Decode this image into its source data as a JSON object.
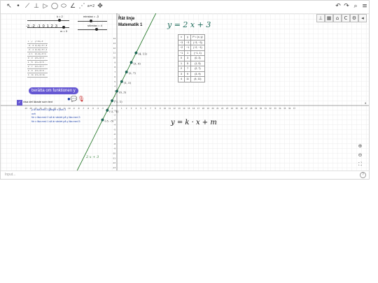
{
  "toolbar": {
    "tools": [
      {
        "name": "move-tool",
        "glyph": "↖"
      },
      {
        "name": "point-tool",
        "glyph": "•"
      },
      {
        "name": "line-tool",
        "glyph": "⟋"
      },
      {
        "name": "perpendicular-tool",
        "glyph": "⊥"
      },
      {
        "name": "polygon-tool",
        "glyph": "▷"
      },
      {
        "name": "circle-tool",
        "glyph": "◯"
      },
      {
        "name": "ellipse-tool",
        "glyph": "⬭"
      },
      {
        "name": "angle-tool",
        "glyph": "∠"
      },
      {
        "name": "reflect-tool",
        "glyph": "⋰"
      },
      {
        "name": "slider-tool",
        "glyph": "a=2"
      },
      {
        "name": "move-view-tool",
        "glyph": "✥"
      }
    ],
    "right": [
      {
        "name": "undo-icon",
        "glyph": "↶"
      },
      {
        "name": "redo-icon",
        "glyph": "↷"
      },
      {
        "name": "search-icon",
        "glyph": "⌕"
      },
      {
        "name": "menu-icon",
        "glyph": "≡"
      }
    ]
  },
  "stylebar": [
    {
      "name": "axes-toggle-icon",
      "glyph": "⊥"
    },
    {
      "name": "grid-toggle-icon",
      "glyph": "▦"
    },
    {
      "name": "home-icon",
      "glyph": "⌂"
    },
    {
      "name": "point-capture-icon",
      "glyph": "C"
    },
    {
      "name": "settings-icon",
      "glyph": "⚙"
    },
    {
      "name": "collapse-icon",
      "glyph": "◂"
    }
  ],
  "sliders": {
    "k": {
      "label": "k = 2",
      "value": 2,
      "min": -3,
      "max": 3
    },
    "m": {
      "label": "m = 3",
      "value": 3
    },
    "minsta": {
      "label": "minstax = -3",
      "value": -3
    },
    "storsta": {
      "label": "störstax = 4",
      "value": 4
    }
  },
  "number_line": {
    "ticks": [
      "-3",
      "-2",
      "-1",
      "0",
      "1",
      "2",
      "3"
    ]
  },
  "title": {
    "line1": "Rät linje",
    "line2": "Matematik 1"
  },
  "equation_main": "y = 2 x + 3",
  "equation_general": "y = k · x + m",
  "line_label": "2 x + 3",
  "table": {
    "headers": [
      "x",
      "y",
      "P = (x, y)"
    ],
    "rows": [
      [
        "−3",
        "−3",
        "(−3, −3)"
      ],
      [
        "−2",
        "−1",
        "(−2, −1)"
      ],
      [
        "−1",
        "1",
        "(−1, 1)"
      ],
      [
        "0",
        "3",
        "(0, 3)"
      ],
      [
        "1",
        "5",
        "(1, 5)"
      ],
      [
        "2",
        "7",
        "(2, 7)"
      ],
      [
        "3",
        "9",
        "(3, 9)"
      ],
      [
        "4",
        "11",
        "(4, 11)"
      ]
    ]
  },
  "calc_table": {
    "headers": [
      "x",
      "y",
      "y = 2x + 3"
    ],
    "rows": [
      [
        "−3",
        "−3",
        "2·(−3) + 3 = −3"
      ],
      [
        "−2",
        "−1",
        "2·(−2) + 3 = −1"
      ],
      [
        "−1",
        "1",
        "2·(−1) + 3 = 1"
      ],
      [
        "0",
        "3",
        "2·0 + 3 = 3"
      ],
      [
        "1",
        "5",
        "2·1 + 3 = 5"
      ],
      [
        "2",
        "7",
        "2·2 + 3 = 7"
      ],
      [
        "3",
        "9",
        "2·3 + 3 = 9"
      ],
      [
        "4",
        "11",
        "2·4 + 3 = 11"
      ]
    ]
  },
  "points": [
    {
      "x": -3,
      "y": -3,
      "label": "(-3, -3)"
    },
    {
      "x": -2,
      "y": -1,
      "label": "(-2, -1)"
    },
    {
      "x": -1,
      "y": 1,
      "label": "(-1, 1)"
    },
    {
      "x": 0,
      "y": 3,
      "label": "(0, 3)"
    },
    {
      "x": 1,
      "y": 5,
      "label": "(1, 5)"
    },
    {
      "x": 2,
      "y": 7,
      "label": "(2, 7)"
    },
    {
      "x": 3,
      "y": 9,
      "label": "(3, 9)"
    },
    {
      "x": 4,
      "y": 11,
      "label": "(4, 11)"
    }
  ],
  "axes": {
    "x_ticks": [
      "-19",
      "-18",
      "-17",
      "-16",
      "-15",
      "-14",
      "-13",
      "-12",
      "-11",
      "-10",
      "-9",
      "-8",
      "-7",
      "-6",
      "-5",
      "-4",
      "-3",
      "-2",
      "-1",
      "1",
      "2",
      "3",
      "4",
      "5",
      "6",
      "7",
      "8",
      "9",
      "10",
      "11",
      "12",
      "13",
      "14",
      "15",
      "16",
      "17",
      "18",
      "19",
      "20",
      "21",
      "22",
      "23",
      "24",
      "25",
      "26",
      "27",
      "28",
      "29",
      "30",
      "31",
      "32",
      "33",
      "34",
      "35",
      "36",
      "37"
    ],
    "y_ticks": [
      "14",
      "13",
      "12",
      "11",
      "10",
      "9",
      "8",
      "7",
      "6",
      "5",
      "4",
      "3",
      "2",
      "1",
      "-1",
      "-2",
      "-3",
      "-4",
      "-5",
      "-6",
      "-7",
      "-8",
      "-9",
      "-10",
      "-11",
      "-12",
      "-13",
      "-14",
      "-15"
    ],
    "x_label": "x",
    "y_label": "y"
  },
  "colors": {
    "line": "#2e7d32",
    "point": "#1e6b5a",
    "accent": "#6557d2",
    "equation": "#1e6b5a"
  },
  "describe_button": "berätta om funktionen y",
  "show_text_checkbox": "visa det lärade som text",
  "explain_lines": [
    "y är lika med 2 gånger x plus 3",
    "och",
    "för x lika med 2 så är värdet på y lika med 3",
    "för x lika med 1 så är värdet på y lika med 5"
  ],
  "input_placeholder": "Input...",
  "help_label": "?"
}
